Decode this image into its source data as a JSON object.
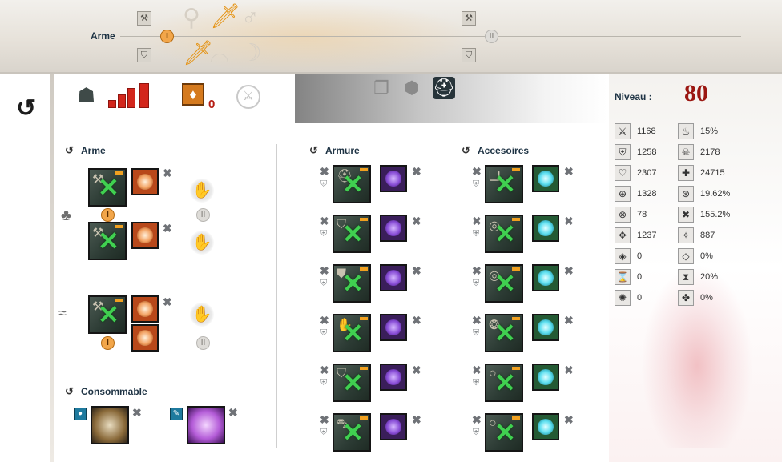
{
  "topbar": {
    "weapon_label": "Arme",
    "set1_badge": "I",
    "set2_badge": "II"
  },
  "header": {
    "level_label": "Niveau :",
    "level_value": "80",
    "infusion_count": "0"
  },
  "sections": {
    "weapon": "Arme",
    "armor": "Armure",
    "accessories": "Accesoires",
    "consumable": "Consommable"
  },
  "weapon_sets": {
    "land_badge_1": "I",
    "land_badge_2": "II",
    "water_badge_1": "I",
    "water_badge_2": "II"
  },
  "stats": [
    {
      "icon": "sword-icon",
      "glyph": "⚔",
      "value": "1168"
    },
    {
      "icon": "flame-icon",
      "glyph": "♨",
      "value": "15%"
    },
    {
      "icon": "shield-icon",
      "glyph": "⛨",
      "value": "1258"
    },
    {
      "icon": "skull-icon",
      "glyph": "☠",
      "value": "2178"
    },
    {
      "icon": "heart-icon",
      "glyph": "♡",
      "value": "2307"
    },
    {
      "icon": "cross-icon",
      "glyph": "✚",
      "value": "24715"
    },
    {
      "icon": "crosshair-icon",
      "glyph": "⊕",
      "value": "1328"
    },
    {
      "icon": "crosshair-circle-icon",
      "glyph": "⊛",
      "value": "19.62%"
    },
    {
      "icon": "x-circle-icon",
      "glyph": "⊗",
      "value": "78"
    },
    {
      "icon": "ferocity-icon",
      "glyph": "✖",
      "value": "155.2%"
    },
    {
      "icon": "diamond-x-icon",
      "glyph": "✥",
      "value": "1237"
    },
    {
      "icon": "spark-icon",
      "glyph": "✧",
      "value": "887"
    },
    {
      "icon": "diamond-a-icon",
      "glyph": "◈",
      "value": "0"
    },
    {
      "icon": "diamond-b-icon",
      "glyph": "◇",
      "value": "0%"
    },
    {
      "icon": "hourglass-icon",
      "glyph": "⌛",
      "value": "0"
    },
    {
      "icon": "hourglass-b-icon",
      "glyph": "⧗",
      "value": "20%"
    },
    {
      "icon": "agony-icon",
      "glyph": "✺",
      "value": "0"
    },
    {
      "icon": "clover-icon",
      "glyph": "✤",
      "value": "0%"
    }
  ],
  "colors": {
    "level_red": "#9b1712",
    "legendary_green": "#40d050",
    "set_orange": "#f2a64a"
  }
}
